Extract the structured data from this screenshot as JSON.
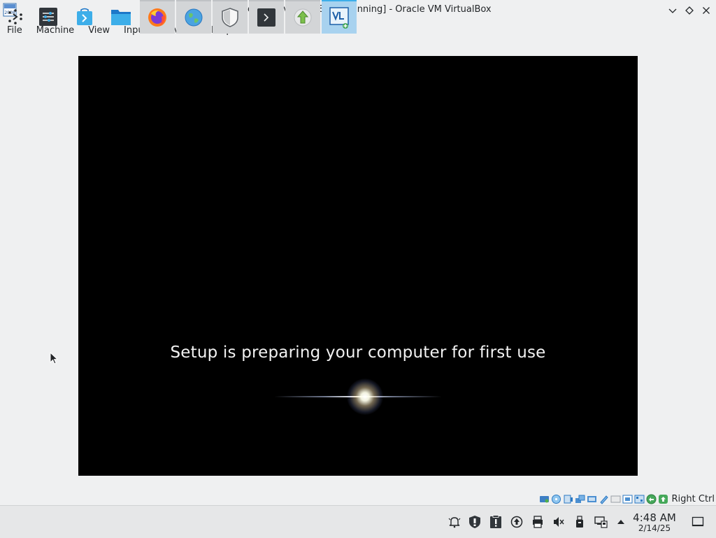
{
  "window": {
    "title": "Windows Server 2008 R2 [Running] - Oracle VM VirtualBox",
    "app_icon": "virtualbox-vm-icon",
    "buttons": [
      "minimize-chevron-icon",
      "maximize-diamond-icon",
      "close-x-icon"
    ]
  },
  "menu": {
    "items": [
      {
        "label": "File"
      },
      {
        "label": "Machine"
      },
      {
        "label": "View"
      },
      {
        "label": "Input"
      },
      {
        "label": "Devices"
      },
      {
        "label": "Help"
      }
    ]
  },
  "vm": {
    "message": "Setup is preparing your computer for first use",
    "background": "#000000"
  },
  "statusbar": {
    "icons": [
      "hard-disk-icon",
      "optical-drive-icon",
      "audio-icon",
      "network-icon",
      "usb-icon",
      "shared-folders-icon",
      "display-icon",
      "recording-icon",
      "cpu-icon",
      "mouse-integration-icon"
    ],
    "host_key": "Right Ctrl"
  },
  "taskbar": {
    "launcher_icon": "application-launcher-icon",
    "items": [
      {
        "name": "system-settings-icon",
        "running": false
      },
      {
        "name": "discover-store-icon",
        "running": false
      },
      {
        "name": "file-manager-icon",
        "running": false
      },
      {
        "name": "firefox-icon",
        "running": true
      },
      {
        "name": "globe-browser-icon",
        "running": true
      },
      {
        "name": "security-shield-icon",
        "running": true
      },
      {
        "name": "terminal-icon",
        "running": true
      },
      {
        "name": "update-arrow-icon",
        "running": true
      },
      {
        "name": "virtualbox-icon",
        "running": true,
        "active": true
      }
    ],
    "tray": [
      "notifications-bell-icon",
      "security-shield-tray-icon",
      "clipboard-icon",
      "updates-tray-icon",
      "printer-icon",
      "volume-muted-icon",
      "usb-drive-tray-icon",
      "network-tray-icon",
      "expand-tray-arrow-icon"
    ],
    "clock": {
      "time": "4:48 AM",
      "date": "2/14/25"
    },
    "show_desktop_icon": "show-desktop-icon"
  }
}
